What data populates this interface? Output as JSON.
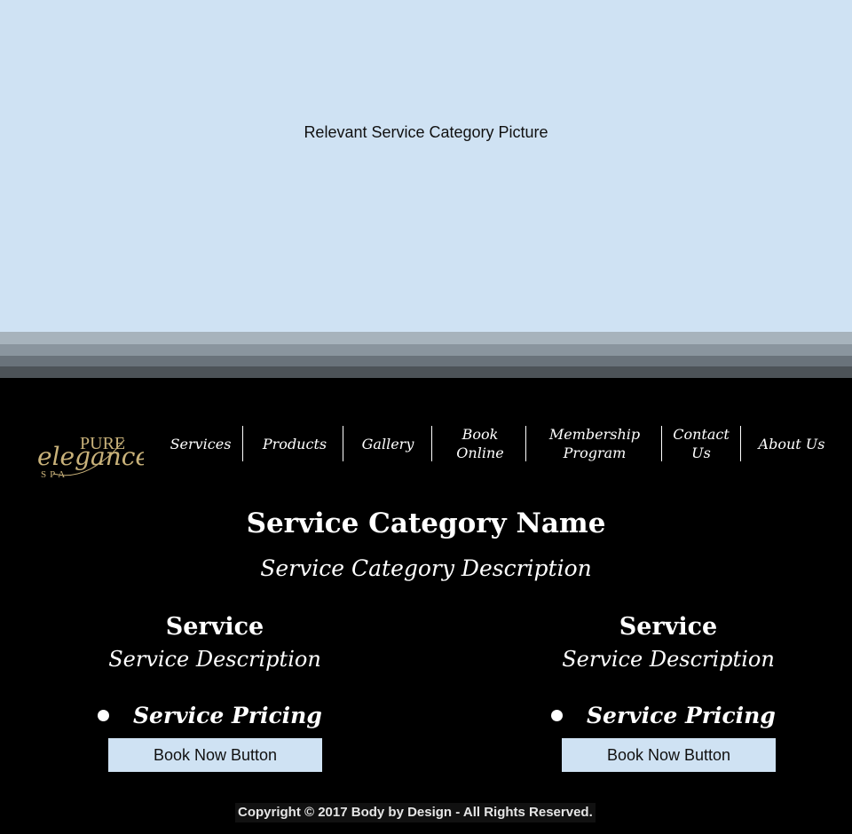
{
  "hero": {
    "label": "Relevant Service Category Picture"
  },
  "logo": {
    "top_text": "PURE",
    "main_text": "elegance",
    "sub_text": "SPA"
  },
  "nav": {
    "services": "Services",
    "products": "Products",
    "gallery": "Gallery",
    "book_online": "Book\nOnline",
    "membership": "Membership\nProgram",
    "contact": "Contact\nUs",
    "about": "About Us"
  },
  "category": {
    "name": "Service Category Name",
    "description": "Service Category Description"
  },
  "services": [
    {
      "title": "Service",
      "description": "Service Description",
      "pricing": "Service Pricing",
      "button": "Book Now Button"
    },
    {
      "title": "Service",
      "description": "Service Description",
      "pricing": "Service Pricing",
      "button": "Book Now Button"
    }
  ],
  "footer": {
    "copyright": "Copyright © 2017 Body by Design - All Rights Reserved."
  },
  "colors": {
    "hero_bg": "#cfe2f3",
    "page_bg": "#000000",
    "logo_gold": "#c9b27a"
  }
}
